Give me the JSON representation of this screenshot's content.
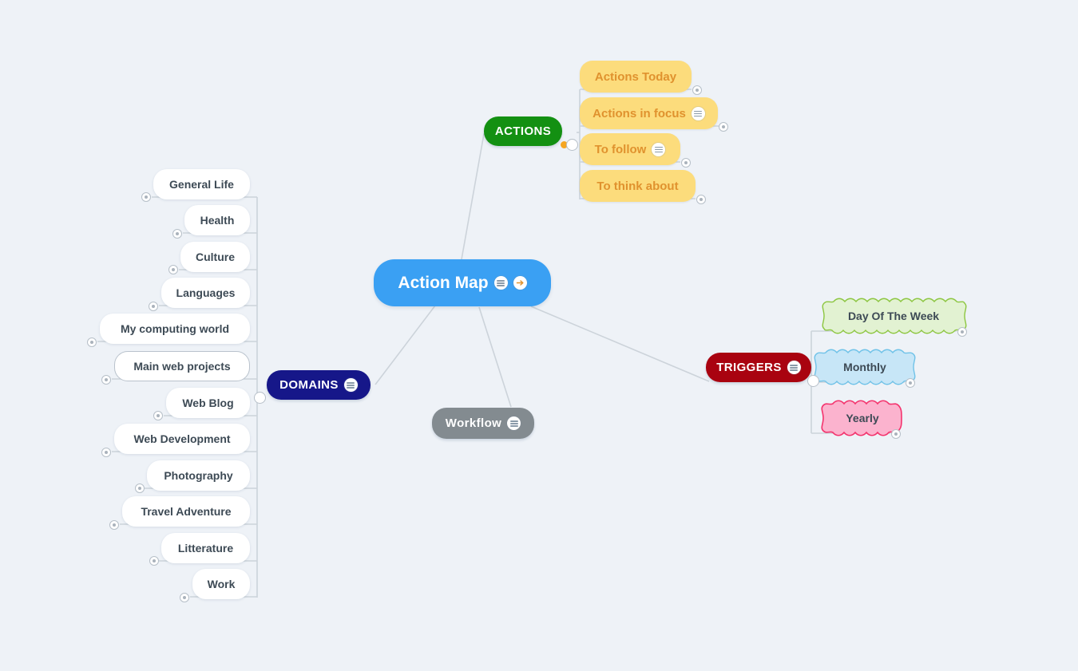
{
  "app": {
    "title": "Action Map",
    "background_color": "#eef2f7"
  },
  "colors": {
    "central": "#3aa0f3",
    "actions": "#139012",
    "domains": "#161789",
    "triggers": "#a90310",
    "workflow": "#838b90",
    "leaf_yellow_bg": "#fcdc7c",
    "leaf_yellow_text": "#e0922e",
    "leaf_white_bg": "#ffffff",
    "leaf_text": "#3d4a55",
    "cloud_green": "#e2f2d2",
    "cloud_green_border": "#8cc63f",
    "cloud_blue": "#c7e6f7",
    "cloud_blue_border": "#6fc2e8",
    "cloud_pink": "#fbb3ce",
    "cloud_pink_border": "#f4336d",
    "edge": "#ccd3da",
    "handle_border": "#b6bfc8"
  },
  "central": {
    "label": "Action Map",
    "icons": [
      "note-icon",
      "arrow-right-icon"
    ]
  },
  "branches": [
    {
      "id": "actions",
      "label": "ACTIONS",
      "color": "#139012",
      "icons": [],
      "children": [
        {
          "label": "Actions Today",
          "icons": [],
          "handle": "collapsed"
        },
        {
          "label": "Actions in focus",
          "icons": [
            "note-icon"
          ],
          "handle": "collapsed"
        },
        {
          "label": "To follow",
          "icons": [
            "note-icon"
          ],
          "handle": "collapsed"
        },
        {
          "label": "To think about",
          "icons": [],
          "handle": "collapsed"
        }
      ]
    },
    {
      "id": "domains",
      "label": "DOMAINS",
      "color": "#161789",
      "icons": [
        "note-icon"
      ],
      "children": [
        {
          "label": "General Life",
          "handle": "collapsed",
          "style": "filled"
        },
        {
          "label": "Health",
          "handle": "collapsed",
          "style": "filled"
        },
        {
          "label": "Culture",
          "handle": "collapsed",
          "style": "filled"
        },
        {
          "label": "Languages",
          "handle": "collapsed",
          "style": "filled"
        },
        {
          "label": "My computing world",
          "handle": "collapsed",
          "style": "filled"
        },
        {
          "label": "Main web projects",
          "handle": "collapsed",
          "style": "outlined"
        },
        {
          "label": "Web Blog",
          "handle": "collapsed",
          "style": "filled"
        },
        {
          "label": "Web Development",
          "handle": "collapsed",
          "style": "filled"
        },
        {
          "label": "Photography",
          "handle": "collapsed",
          "style": "filled"
        },
        {
          "label": "Travel Adventure",
          "handle": "collapsed",
          "style": "filled"
        },
        {
          "label": "Litterature",
          "handle": "collapsed",
          "style": "filled"
        },
        {
          "label": "Work",
          "handle": "collapsed",
          "style": "filled"
        }
      ]
    },
    {
      "id": "triggers",
      "label": "TRIGGERS",
      "color": "#a90310",
      "icons": [
        "note-icon"
      ],
      "children": [
        {
          "label": "Day Of The Week",
          "handle": "collapsed",
          "cloud": "green"
        },
        {
          "label": "Monthly",
          "handle": "collapsed",
          "cloud": "blue"
        },
        {
          "label": "Yearly",
          "handle": "collapsed",
          "cloud": "pink"
        }
      ]
    },
    {
      "id": "workflow",
      "label": "Workflow",
      "color": "#838b90",
      "icons": [
        "note-icon"
      ],
      "children": []
    }
  ]
}
